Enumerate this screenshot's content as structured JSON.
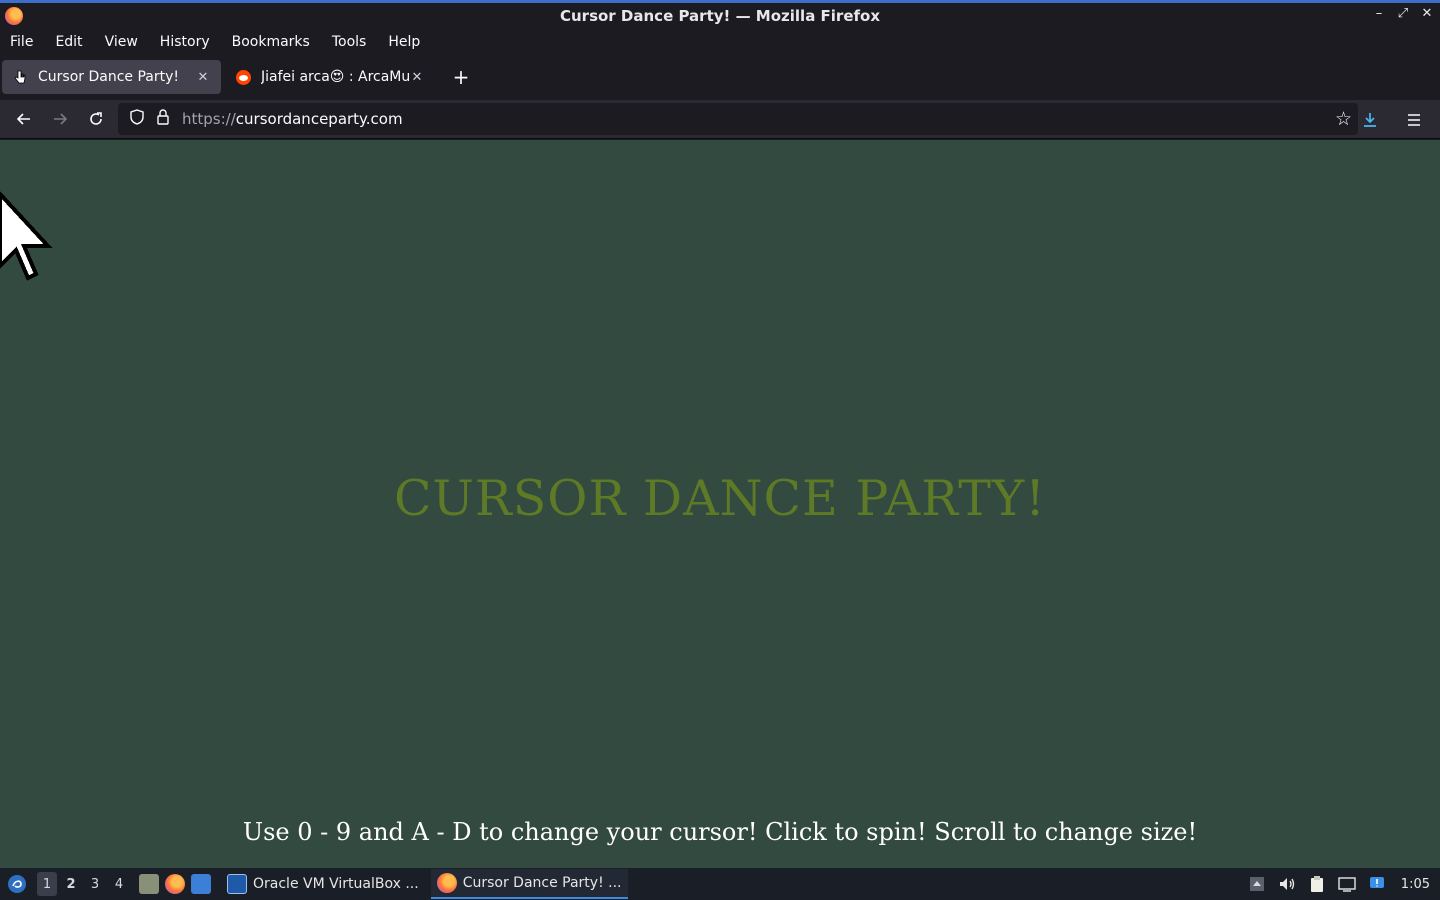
{
  "window": {
    "title": "Cursor Dance Party! — Mozilla Firefox",
    "minimize": "–",
    "restore": "⤢",
    "close": "✕"
  },
  "menubar": {
    "items": [
      "File",
      "Edit",
      "View",
      "History",
      "Bookmarks",
      "Tools",
      "Help"
    ]
  },
  "tabs": [
    {
      "label": "Cursor Dance Party!",
      "active": true
    },
    {
      "label": "Jiafei arca😍 : ArcaMusic",
      "active": false
    }
  ],
  "navbar": {
    "url_protocol": "https://",
    "url_host": "cursordanceparty.com"
  },
  "page": {
    "heading": "CURSOR DANCE PARTY!",
    "instructions": "Use 0 - 9 and A - D to change your cursor! Click to spin! Scroll to change size!",
    "background_color": "#324a3f",
    "heading_color": "#5f7a26"
  },
  "taskbar": {
    "workspaces": [
      "1",
      "2",
      "3",
      "4"
    ],
    "apps": [
      {
        "label": "Oracle VM VirtualBox ...",
        "active": false
      },
      {
        "label": "Cursor Dance Party! ...",
        "active": true
      }
    ],
    "clock": "1:05"
  }
}
